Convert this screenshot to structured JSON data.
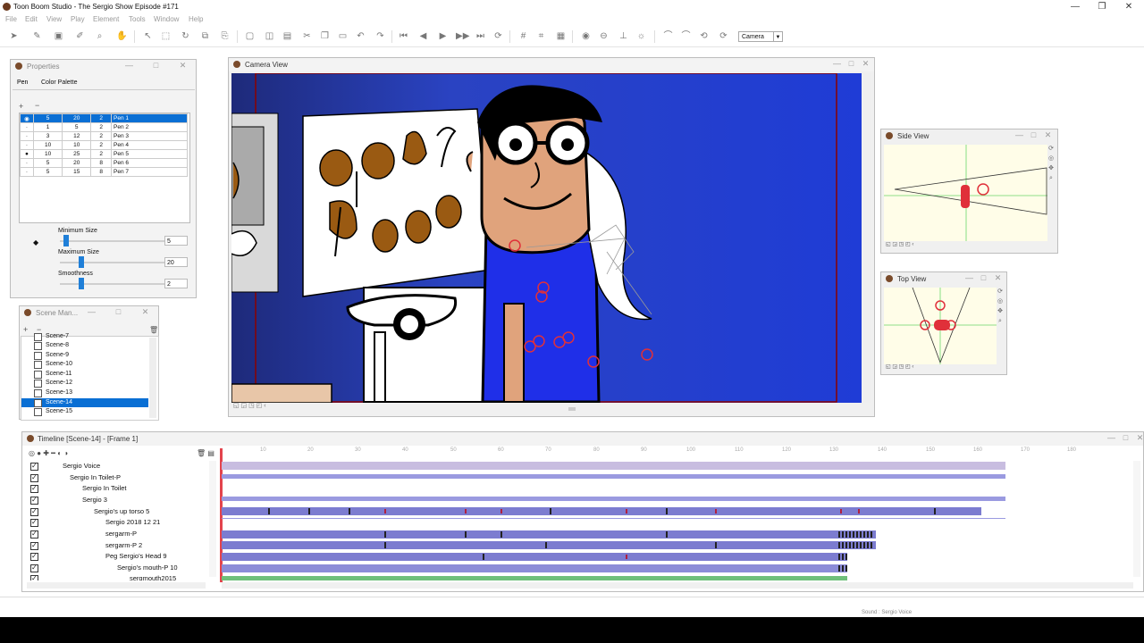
{
  "app": {
    "title": "Toon Boom Studio - The Sergio Show Episode #171",
    "menu": [
      "File",
      "Edit",
      "View",
      "Play",
      "Element",
      "Tools",
      "Window",
      "Help"
    ],
    "window_controls": {
      "minimize": "—",
      "restore": "❐",
      "close": "✕"
    }
  },
  "toolbar": {
    "camera_select": "Camera"
  },
  "properties": {
    "title": "Properties",
    "tabs": [
      "Pen",
      "Color Palette"
    ],
    "pens": [
      {
        "a": "5",
        "b": "20",
        "c": "2",
        "name": "Pen 1"
      },
      {
        "a": "1",
        "b": "5",
        "c": "2",
        "name": "Pen 2"
      },
      {
        "a": "3",
        "b": "12",
        "c": "2",
        "name": "Pen 3"
      },
      {
        "a": "10",
        "b": "10",
        "c": "2",
        "name": "Pen 4"
      },
      {
        "a": "10",
        "b": "25",
        "c": "2",
        "name": "Pen 5"
      },
      {
        "a": "5",
        "b": "20",
        "c": "8",
        "name": "Pen 6"
      },
      {
        "a": "5",
        "b": "15",
        "c": "8",
        "name": "Pen 7"
      }
    ],
    "selected_pen": "Pen 1",
    "min_size_label": "Minimum Size",
    "min_size_value": "5",
    "max_size_label": "Maximum Size",
    "max_size_value": "20",
    "smoothness_label": "Smoothness",
    "smoothness_value": "2"
  },
  "scene_manager": {
    "title": "Scene Man...",
    "items": [
      "Scene-7",
      "Scene-8",
      "Scene-9",
      "Scene-10",
      "Scene-11",
      "Scene-12",
      "Scene-13",
      "Scene-14",
      "Scene-15"
    ],
    "selected": "Scene-14"
  },
  "camera_view": {
    "title": "Camera View"
  },
  "side_view": {
    "title": "Side View"
  },
  "top_view": {
    "title": "Top View"
  },
  "timeline": {
    "title": "Timeline [Scene-14] - [Frame 1]",
    "ruler": [
      "10",
      "20",
      "30",
      "40",
      "50",
      "60",
      "70",
      "80",
      "90",
      "100",
      "110",
      "120",
      "130",
      "140",
      "150",
      "160",
      "170",
      "180"
    ],
    "layers": [
      {
        "name": "Sergio Voice",
        "indent": 0
      },
      {
        "name": "Sergio In Toilet-P",
        "indent": 1
      },
      {
        "name": "Sergio In Toilet",
        "indent": 2
      },
      {
        "name": "Sergio 3",
        "indent": 2
      },
      {
        "name": "Sergio's up torso 5",
        "indent": 3
      },
      {
        "name": "Sergio 2018 12 21",
        "indent": 4
      },
      {
        "name": "sergarm-P",
        "indent": 4
      },
      {
        "name": "sergarm-P 2",
        "indent": 4
      },
      {
        "name": "Peg Sergio's Head 9",
        "indent": 4
      },
      {
        "name": "Sergio's mouth-P 10",
        "indent": 5
      },
      {
        "name": "sergmouth2015",
        "indent": 6
      }
    ]
  },
  "status": {
    "text": "Sound : Sergio Voice"
  },
  "colors": {
    "selection": "#0a6fd4",
    "stage_blue": "#2a3ea8",
    "track_purple": "#9090d8"
  }
}
